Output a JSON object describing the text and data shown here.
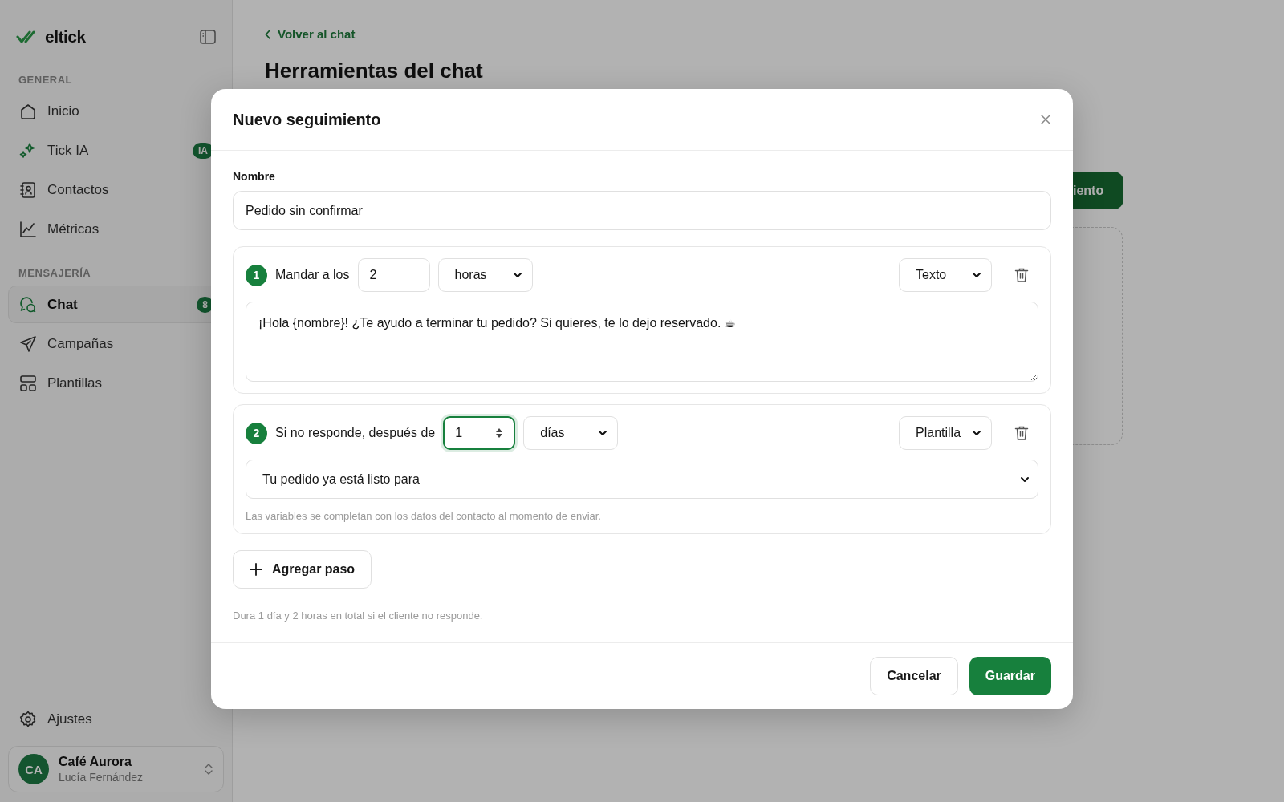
{
  "sidebar": {
    "logo": "eltick",
    "sections": [
      {
        "title": "GENERAL",
        "items": [
          {
            "label": "Inicio",
            "kind": "home",
            "selected": false
          },
          {
            "label": "Tick IA",
            "kind": "sparkle",
            "selected": false,
            "badge": "IA"
          },
          {
            "label": "Contactos",
            "kind": "contacts",
            "selected": false
          },
          {
            "label": "Métricas",
            "kind": "chart",
            "selected": false
          }
        ]
      },
      {
        "title": "MENSAJERÍA",
        "items": [
          {
            "label": "Chat",
            "kind": "chat",
            "selected": true,
            "badge": "8"
          },
          {
            "label": "Campañas",
            "kind": "send",
            "selected": false
          },
          {
            "label": "Plantillas",
            "kind": "layout",
            "selected": false
          }
        ]
      }
    ],
    "settings": {
      "label": "Ajustes"
    },
    "account": {
      "initials": "CA",
      "name": "Café Aurora",
      "user": "Lucía Fernández"
    }
  },
  "page": {
    "back_link": "Volver al chat",
    "title": "Herramientas del chat",
    "button": "iento"
  },
  "modal": {
    "title": "Nuevo seguimiento",
    "name_label": "Nombre",
    "name_value": "Pedido sin confirmar",
    "steps": [
      {
        "kind": "text",
        "number": "1",
        "label": "Mandar a los",
        "amount": "2",
        "focused": false,
        "unit": "horas",
        "type": "Texto",
        "message": "¡Hola {nombre}! ¿Te ayudo a terminar tu pedido? Si quieres, te lo dejo reservado. ☕"
      },
      {
        "kind": "template",
        "number": "2",
        "label": "Si no responde, después de",
        "amount": "1",
        "focused": true,
        "unit": "días",
        "type": "Plantilla",
        "template": "Tu pedido ya está listo para",
        "hint": "Las variables se completan con los datos del contacto al momento de enviar."
      }
    ],
    "add_step": "Agregar paso",
    "summary": "Dura 1 día y 2 horas en total si el cliente no responde.",
    "cancel": "Cancelar",
    "save": "Guardar"
  }
}
